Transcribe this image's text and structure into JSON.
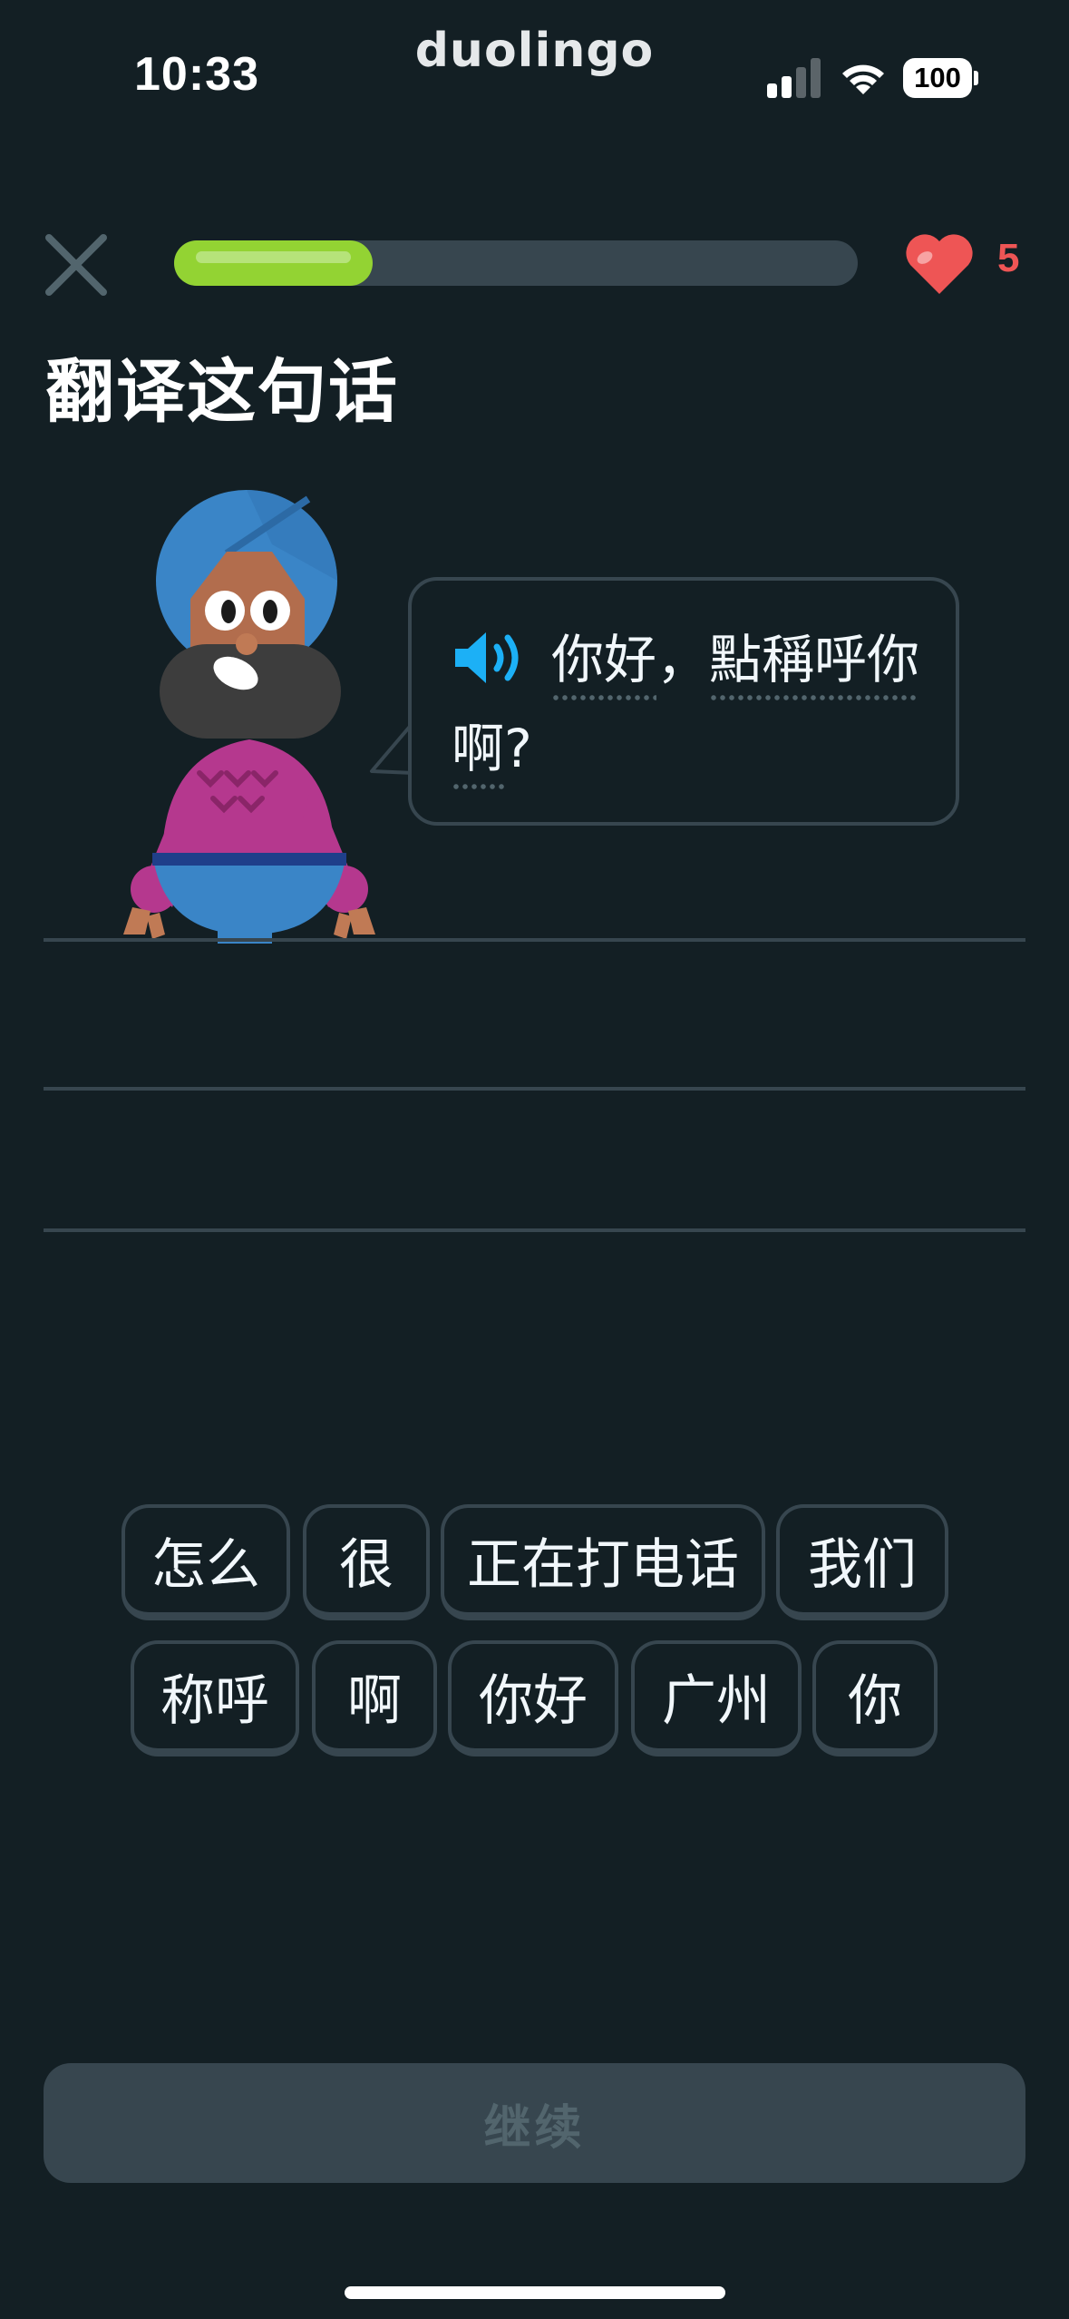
{
  "status_bar": {
    "time": "10:33",
    "brand": "duolingo",
    "battery": "100",
    "icons": [
      "cellular-signal-icon",
      "wifi-icon",
      "battery-icon"
    ]
  },
  "top_bar": {
    "close_icon": "close-icon",
    "progress": 0.29,
    "hearts_icon": "heart-icon",
    "hearts": "5"
  },
  "title": "翻译这句话",
  "prompt": {
    "speaker_icon": "speaker-icon",
    "segments": [
      "你好",
      "，",
      "點稱呼你",
      "啊",
      "?"
    ]
  },
  "word_bank": {
    "row1": [
      "怎么",
      "很",
      "正在打电话",
      "我们"
    ],
    "row2": [
      "称呼",
      "啊",
      "你好",
      "广州",
      "你"
    ]
  },
  "continue_label": "继续",
  "colors": {
    "background": "#131f24",
    "border": "#37464f",
    "progress": "#93d333",
    "heart": "#ee5555",
    "speaker": "#1cb0f6"
  }
}
